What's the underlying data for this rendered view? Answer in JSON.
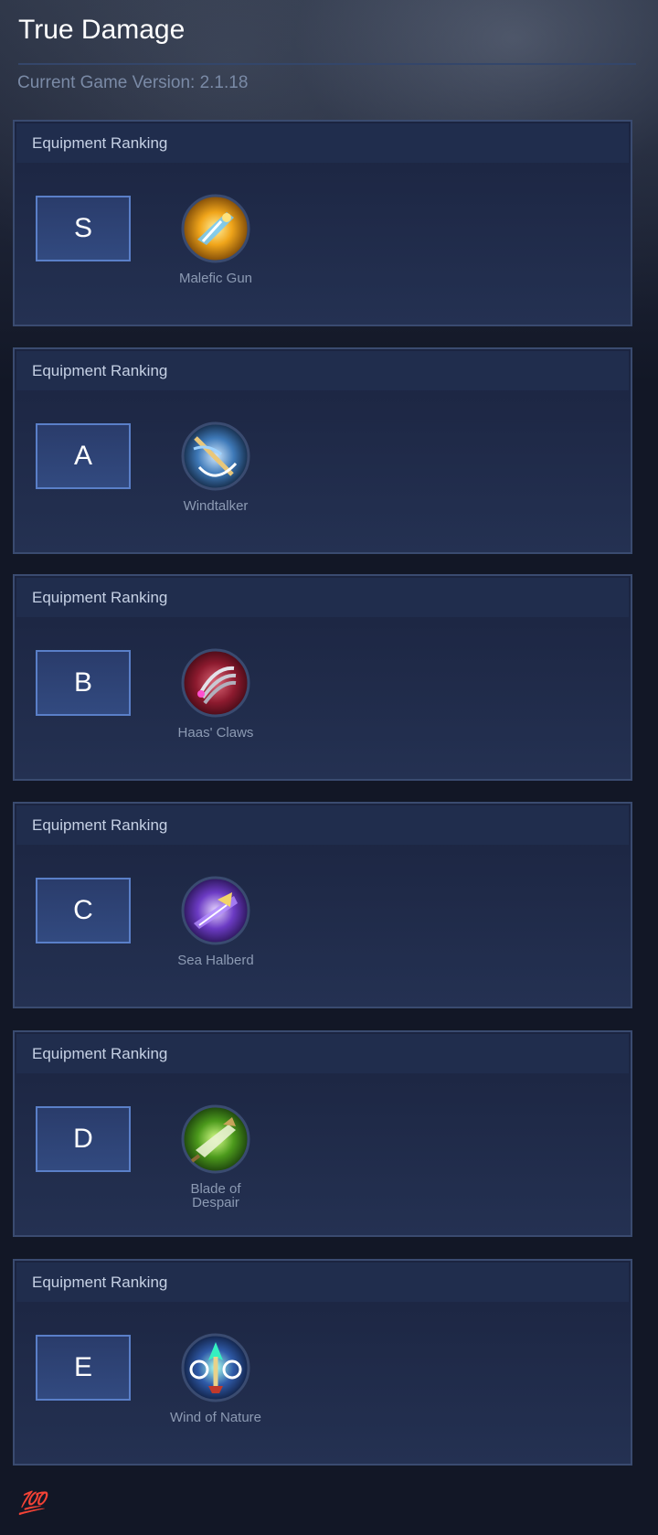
{
  "page": {
    "title": "True Damage",
    "version_label": "Current Game Version: 2.1.18"
  },
  "cards": [
    {
      "header": "Equipment Ranking",
      "tier": "S",
      "item_name": "Malefic Gun",
      "icon": "malefic-gun-icon"
    },
    {
      "header": "Equipment Ranking",
      "tier": "A",
      "item_name": "Windtalker",
      "icon": "windtalker-icon"
    },
    {
      "header": "Equipment Ranking",
      "tier": "B",
      "item_name": "Haas' Claws",
      "icon": "haas-claws-icon"
    },
    {
      "header": "Equipment Ranking",
      "tier": "C",
      "item_name": "Sea Halberd",
      "icon": "sea-halberd-icon"
    },
    {
      "header": "Equipment Ranking",
      "tier": "D",
      "item_name": "Blade of Despair",
      "icon": "blade-of-despair-icon"
    },
    {
      "header": "Equipment Ranking",
      "tier": "E",
      "item_name": "Wind of Nature",
      "icon": "wind-of-nature-icon"
    }
  ],
  "footer": {
    "emoji": "💯"
  },
  "colors": {
    "background": "#121726",
    "card_border": "#3a4b70",
    "tier_border": "#5a7fc8",
    "header_text": "#c6d1e5",
    "item_text": "#8c9ab3"
  }
}
